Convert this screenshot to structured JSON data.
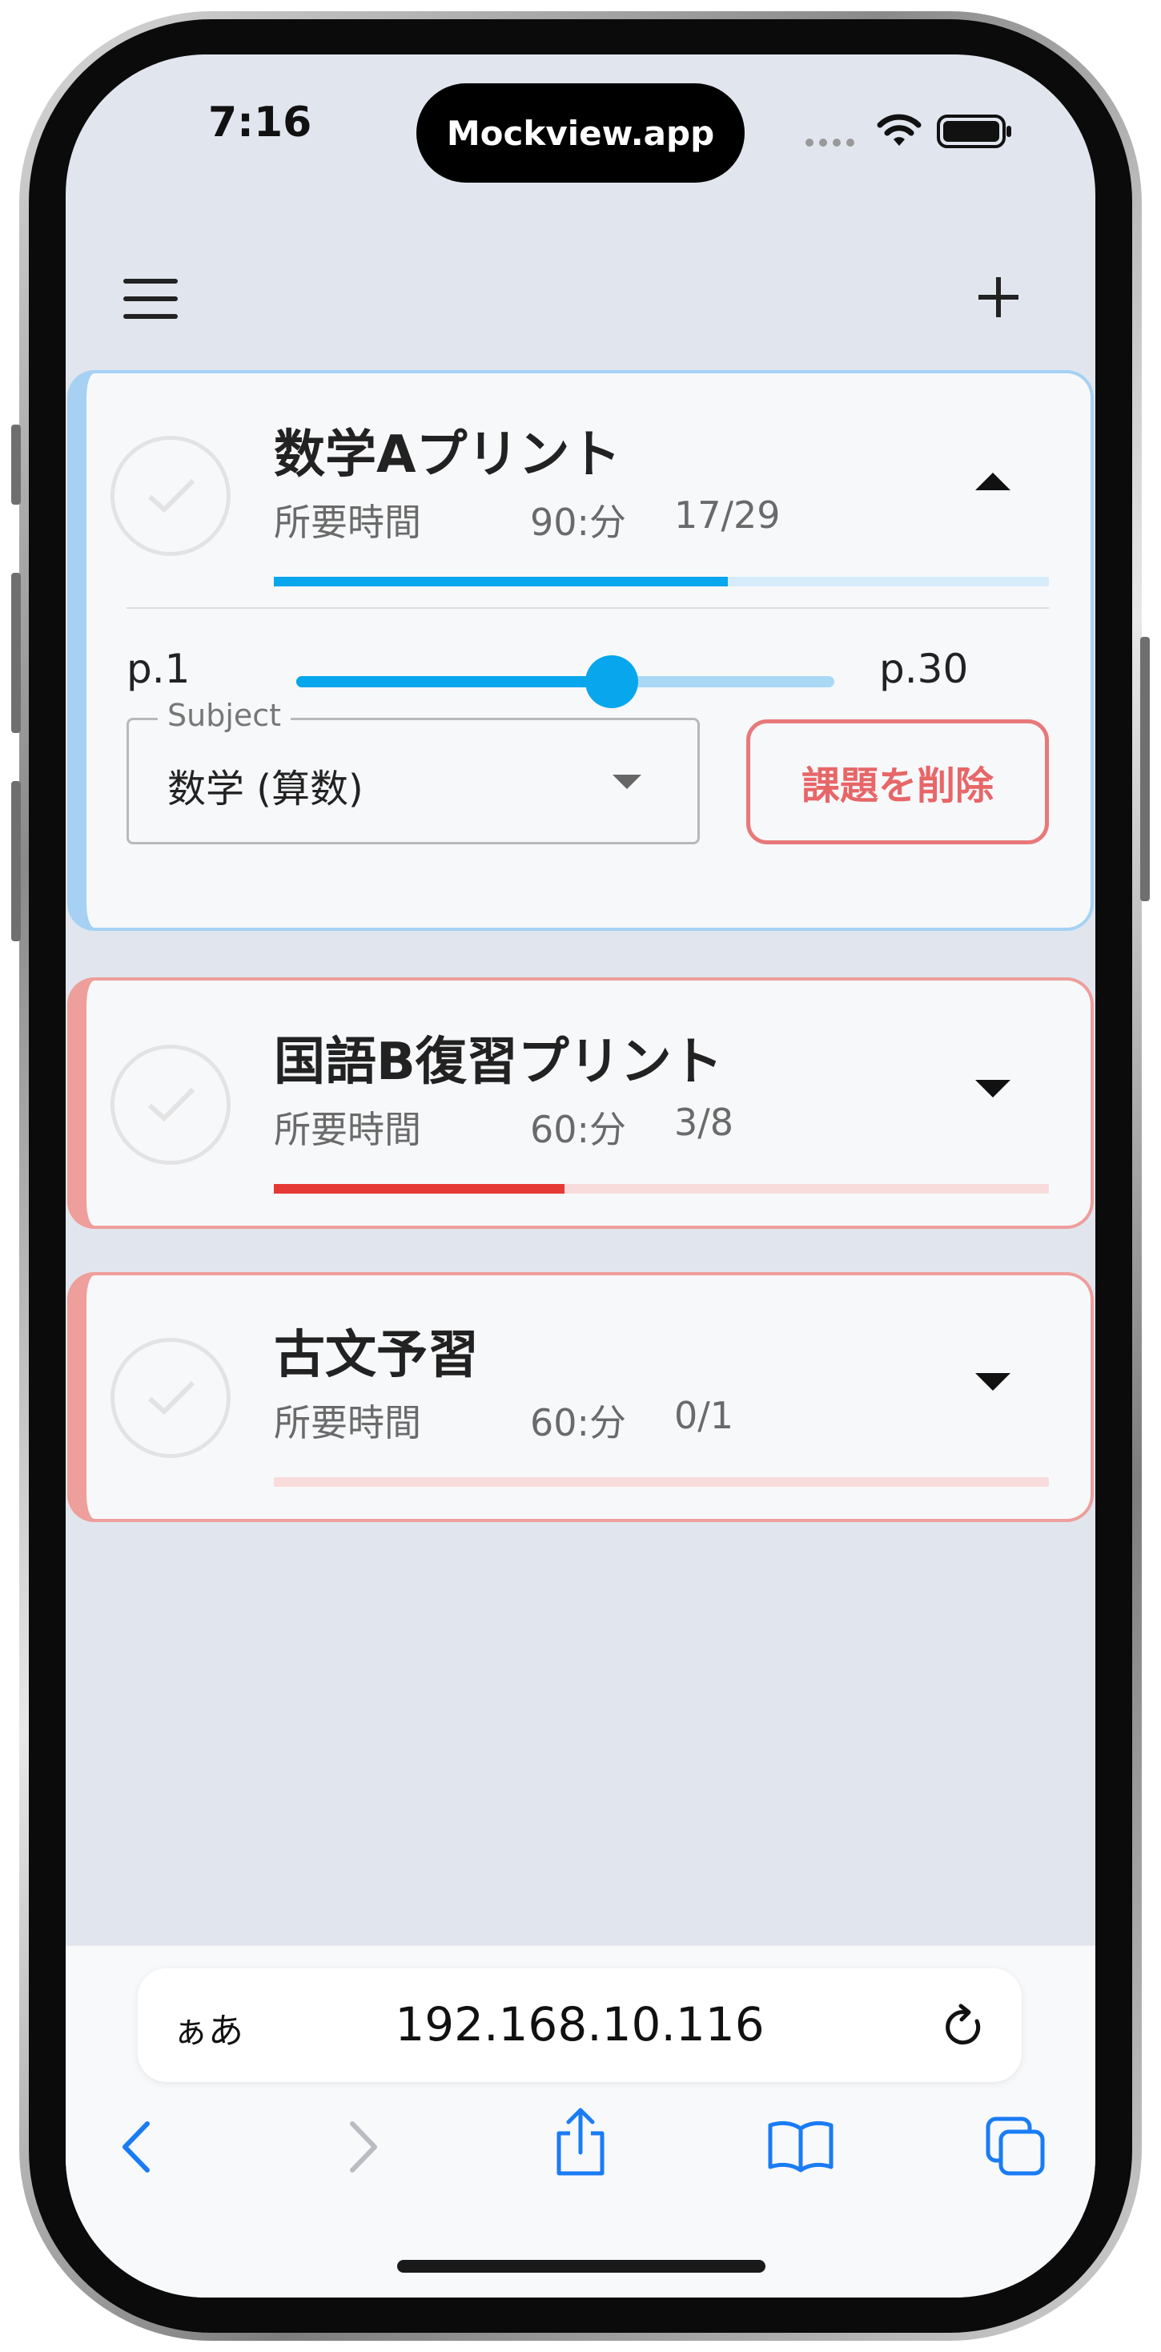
{
  "status_bar": {
    "time": "7:16",
    "site_pill": "Mockview.app"
  },
  "tasks": [
    {
      "title": "数学Aプリント",
      "time_label": "所要時間",
      "duration": "90:分",
      "progress_text": "17/29",
      "progress_fraction": 0.586,
      "expanded": true,
      "color": "#08a6ec",
      "slider": {
        "min_label": "p.1",
        "max_label": "p.30",
        "value_fraction": 0.586
      },
      "subject_label": "Subject",
      "subject_value": "数学 (算数)",
      "delete_label": "課題を削除"
    },
    {
      "title": "国語B復習プリント",
      "time_label": "所要時間",
      "duration": "60:分",
      "progress_text": "3/8",
      "progress_fraction": 0.375,
      "expanded": false,
      "color": "#e53935"
    },
    {
      "title": "古文予習",
      "time_label": "所要時間",
      "duration": "60:分",
      "progress_text": "0/1",
      "progress_fraction": 0,
      "expanded": false,
      "color": "#e53935"
    }
  ],
  "browser": {
    "aa_label": "ぁあ",
    "url": "192.168.10.116"
  },
  "icons": [
    "menu-icon",
    "add-icon",
    "check-icon",
    "caret-up-icon",
    "caret-down-icon",
    "dropdown-arrow-icon",
    "wifi-icon",
    "battery-icon",
    "reload-icon",
    "back-icon",
    "forward-icon",
    "share-icon",
    "bookmarks-icon",
    "tabs-icon"
  ],
  "colors": {
    "accent_blue": "#08a6ec",
    "accent_red": "#e53935",
    "delete_red": "#e76668",
    "background": "#e1e6ee"
  }
}
